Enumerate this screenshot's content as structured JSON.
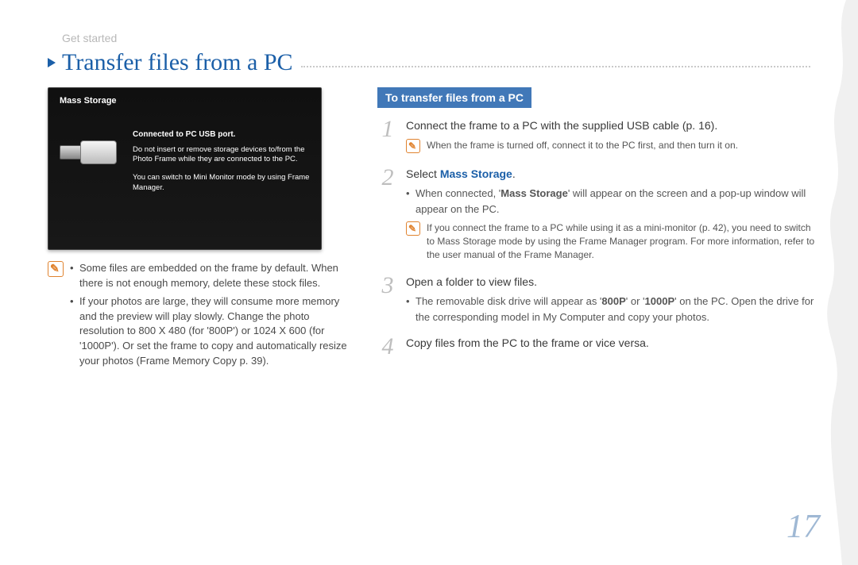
{
  "breadcrumb": "Get started",
  "title": "Transfer files from a PC",
  "page_number": "17",
  "screenshot": {
    "title": "Mass Storage",
    "heading": "Connected to PC USB port.",
    "para1": "Do not insert or remove storage devices to/from the Photo Frame while they are connected to the PC.",
    "para2": "You can switch to Mini Monitor mode by using Frame Manager."
  },
  "left_notes": {
    "item1": "Some files are embedded on the frame by default. When there is not enough memory, delete these stock files.",
    "item2": "If your photos are large, they will consume more memory and the preview will play slowly. Change the photo resolution to 800 X 480 (for '800P') or 1024 X 600 (for '1000P'). Or set the frame to copy and automatically resize your photos (Frame Memory Copy p. 39)."
  },
  "section_header": "To transfer files from a PC",
  "steps": [
    {
      "num": "1",
      "text": "Connect the frame to a PC with the supplied USB cable (p. 16).",
      "subnote": "When the frame is turned off, connect it to the PC first, and then turn it on."
    },
    {
      "num": "2",
      "text_prefix": "Select ",
      "text_emph": "Mass Storage",
      "text_suffix": ".",
      "bullets_html": "When connected, '<b>Mass Storage</b>' will appear on the screen and a pop-up window will appear on the PC.",
      "subnote": "If you connect the frame to a PC while using it as a mini-monitor (p. 42), you need to switch to Mass Storage mode by using the Frame Manager program. For more information, refer to the user manual of the Frame Manager."
    },
    {
      "num": "3",
      "text": "Open a folder to view files.",
      "bullets_html": "The removable disk drive will appear as '<b>800P</b>' or '<b>1000P</b>' on the PC. Open the drive for the corresponding model in My Computer and copy your photos."
    },
    {
      "num": "4",
      "text": "Copy files from the PC to the frame or vice versa."
    }
  ]
}
